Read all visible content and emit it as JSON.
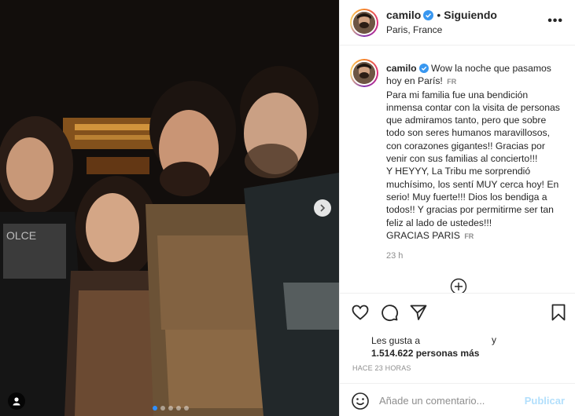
{
  "post": {
    "image_alt": "Group photo",
    "carousel": {
      "count": 5,
      "active_index": 0
    }
  },
  "header": {
    "username": "camilo",
    "separator": "•",
    "following_label": "Siguiendo",
    "location": "Paris, France",
    "more_label": "•••"
  },
  "caption": {
    "username": "camilo",
    "first_line": "Wow la noche que pasamos",
    "lines": [
      "hoy en París!",
      "Para mi familia fue una bendición",
      "inmensa contar con la visita de personas",
      "que admiramos tanto, pero que sobre",
      "todo son seres humanos maravillosos,",
      "con corazones gigantes!! Gracias por",
      "venir con sus familias al concierto!!!",
      "Y HEYYY, La Tribu me sorprendió",
      "muchísimo, los sentí MUY cerca hoy! En",
      "serio! Muy fuerte!!! Dios los bendiga a",
      "todos!! Y gracias por permitirme ser tan",
      "feliz al lado de ustedes!!!",
      "GRACIAS PARIS"
    ],
    "lang_tag": "FR",
    "lang_tag_2": "FR",
    "time": "23 h"
  },
  "likes": {
    "prefix": "Les gusta a",
    "suffix": "y",
    "count_text": "1.514.622 personas más"
  },
  "posted_ago": "HACE 23 HORAS",
  "comment": {
    "placeholder": "Añade un comentario...",
    "publish_label": "Publicar"
  },
  "colors": {
    "verified": "#3897f0",
    "publish_disabled": "#b2dffc",
    "muted": "#8e8e8e",
    "text": "#262626"
  }
}
